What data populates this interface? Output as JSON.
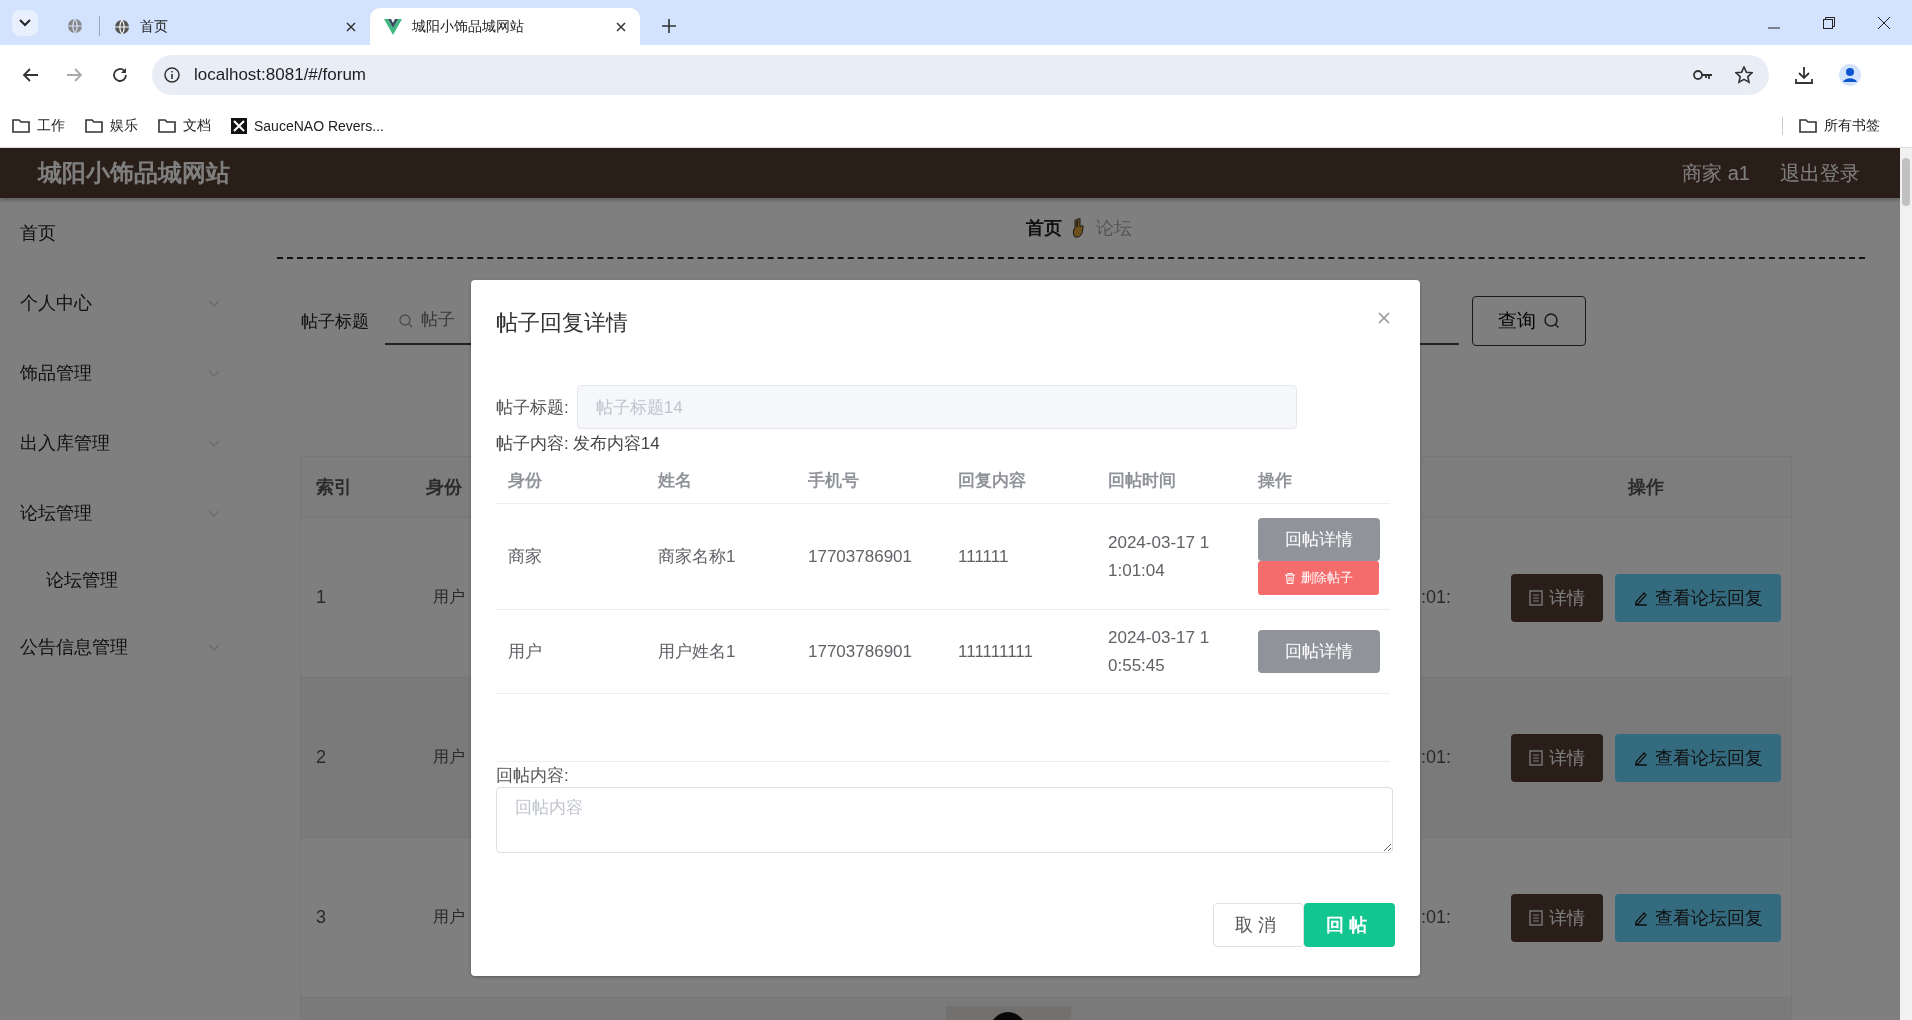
{
  "browser": {
    "tabs": [
      {
        "kind": "pinned",
        "selected": false
      },
      {
        "kind": "site",
        "title": "首页",
        "selected": false
      },
      {
        "kind": "app",
        "title": "城阳小饰品城网站",
        "selected": true
      }
    ],
    "url": "localhost:8081/#/forum",
    "bookmarks": [
      {
        "kind": "folder",
        "label": "工作"
      },
      {
        "kind": "folder",
        "label": "娱乐"
      },
      {
        "kind": "folder",
        "label": "文档"
      },
      {
        "kind": "site",
        "label": "SauceNAO Revers..."
      }
    ],
    "all_bookmarks": "所有书签"
  },
  "header": {
    "title": "城阳小饰品城网站",
    "user": "商家 a1",
    "logout": "退出登录"
  },
  "sidebar": {
    "items": [
      {
        "kind": "link",
        "label": "首页"
      },
      {
        "kind": "group",
        "label": "个人中心"
      },
      {
        "kind": "group",
        "label": "饰品管理"
      },
      {
        "kind": "group",
        "label": "出入库管理"
      },
      {
        "kind": "group",
        "label": "论坛管理",
        "children": [
          {
            "label": "论坛管理"
          }
        ]
      },
      {
        "kind": "group",
        "label": "公告信息管理"
      }
    ]
  },
  "breadcrumb": [
    {
      "label": "首页",
      "selected": true
    },
    {
      "label": "论坛",
      "selected": false
    }
  ],
  "search": {
    "label": "帖子标题",
    "placeholder": "帖子",
    "button": "查询"
  },
  "table": {
    "columns": [
      {
        "label": "索引"
      },
      {
        "label": "身份"
      },
      {
        "label": "操作"
      }
    ],
    "rows": [
      {
        "index": "1",
        "role": "用户",
        "time": ":01:",
        "actions": [
          "详情",
          "查看论坛回复"
        ]
      },
      {
        "index": "2",
        "role": "用户",
        "time": ":01:",
        "actions": [
          "详情",
          "查看论坛回复"
        ]
      },
      {
        "index": "3",
        "role": "用户",
        "time": ":01:",
        "actions": [
          "详情",
          "查看论坛回复"
        ]
      },
      {
        "kind": "picture"
      }
    ]
  },
  "dialog": {
    "title": "帖子回复详情",
    "title_field": {
      "label": "帖子标题:",
      "value": "帖子标题14",
      "disabled": true
    },
    "content": {
      "label": "帖子内容:",
      "value": "发布内容14"
    },
    "columns": [
      "身份",
      "姓名",
      "手机号",
      "回复内容",
      "回帖时间",
      "操作"
    ],
    "rows": [
      {
        "cells": [
          "商家",
          "商家名称1",
          "17703786901",
          "111111",
          "2024-03-17 11:01:04"
        ],
        "actions": [
          {
            "kind": "detail",
            "label": "回帖详情"
          },
          {
            "kind": "delete",
            "label": "删除帖子"
          }
        ]
      },
      {
        "cells": [
          "用户",
          "用户姓名1",
          "17703786901",
          "111111111",
          "2024-03-17 10:55:45"
        ],
        "actions": [
          {
            "kind": "detail",
            "label": "回帖详情"
          }
        ]
      }
    ],
    "reply": {
      "label": "回帖内容:",
      "placeholder": "回帖内容"
    },
    "buttons": [
      {
        "kind": "cancel",
        "label": "取消"
      },
      {
        "kind": "primary",
        "label": "回帖"
      }
    ]
  }
}
